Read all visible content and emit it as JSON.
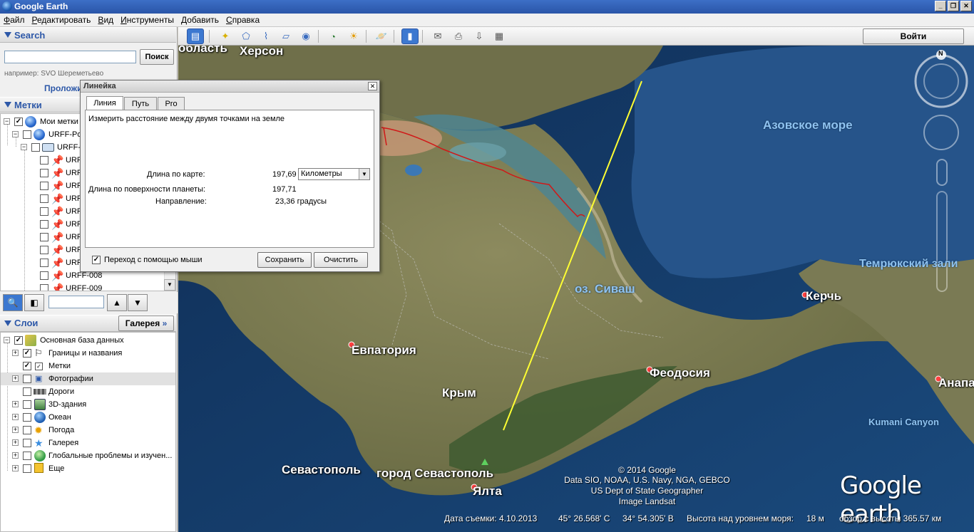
{
  "window": {
    "title": "Google Earth"
  },
  "menu": [
    "Файл",
    "Редактировать",
    "Вид",
    "Инструменты",
    "Добавить",
    "Справка"
  ],
  "search": {
    "header": "Search",
    "button": "Поиск",
    "hint": "например: SVO Шереметьево",
    "link": "Проложить маршрут"
  },
  "places": {
    "header": "Метки",
    "root": "Мои метки",
    "folder1": "URFF-Pos",
    "folder2": "URFF-",
    "items": [
      "URFF",
      "URFF",
      "URFF",
      "URFF",
      "URFF",
      "URFF",
      "URFF",
      "URFF",
      "URFF",
      "URFF-008",
      "URFF-009"
    ]
  },
  "layers": {
    "header": "Слои",
    "gallery_button": "Галерея",
    "root": "Основная база данных",
    "items": [
      {
        "label": "Границы и названия",
        "checked": true
      },
      {
        "label": "Метки",
        "checked": true
      },
      {
        "label": "Фотографии",
        "checked": false
      },
      {
        "label": "Дороги",
        "checked": false
      },
      {
        "label": "3D-здания",
        "checked": false
      },
      {
        "label": "Океан",
        "checked": false
      },
      {
        "label": "Погода",
        "checked": false
      },
      {
        "label": "Галерея",
        "checked": false
      },
      {
        "label": "Глобальные проблемы и изучен...",
        "checked": false
      },
      {
        "label": "Еще",
        "checked": false
      }
    ]
  },
  "toolbar": {
    "signin": "Войти"
  },
  "ruler": {
    "title": "Линейка",
    "tabs": [
      "Линия",
      "Путь",
      "Pro"
    ],
    "description": "Измерить расстояние между двумя точками на земле",
    "map_length_label": "Длина по карте:",
    "map_length_value": "197,69",
    "unit": "Километры",
    "ground_length_label": "Длина по поверхности планеты:",
    "ground_length_value": "197,71",
    "heading_label": "Направление:",
    "heading_value": "23,36 градусы",
    "mouse_nav_label": "Переход с помощью мыши",
    "save": "Сохранить",
    "clear": "Очистить"
  },
  "map": {
    "labels": {
      "oblast": "область",
      "kherson": "Херсон",
      "azov": "Азовское море",
      "temryuk": "Темрюкский зали",
      "sivash": "оз. Сиваш",
      "kerch": "Керчь",
      "evpatoria": "Евпатория",
      "feodosia": "Феодосия",
      "krym": "Крым",
      "anapa": "Анапа",
      "kumani": "Kumani Canyon",
      "sevastopol": "Севастополь",
      "gorod_sevastopol": "город Севастополь",
      "yalta": "Ялта"
    },
    "attribution": [
      "© 2014 Google",
      "Data SIO, NOAA, U.S. Navy, NGA, GEBCO",
      "US Dept of State Geographer",
      "Image Landsat"
    ],
    "logo_a": "Google",
    "logo_b": "earth",
    "compass_north": "N",
    "status": {
      "date": "Дата съемки: 4.10.2013",
      "lat": "45° 26.568' С",
      "lon": "34° 54.305' В",
      "elev": "Высота над уровнем моря:",
      "elev_value": "18 м",
      "eye": "обзор с высоты 365.57 км"
    }
  }
}
